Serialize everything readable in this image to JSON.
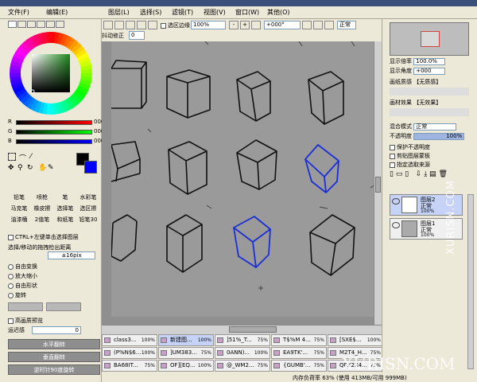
{
  "menu": [
    "文件(F)",
    "编辑(E)",
    "图层(L)",
    "选择(S)",
    "滤镜(T)",
    "视图(V)",
    "窗口(W)",
    "其他(O)"
  ],
  "toolbar": {
    "stabilizer_label": "抖动修正",
    "stabilizer_value": "0",
    "selection_edge_label": "选区边缘",
    "zoom_value": "100%",
    "rotation_value": "+000°",
    "blend_mode": "正常"
  },
  "left": {
    "rgb_labels": [
      "R",
      "G",
      "B"
    ],
    "rgb_values": [
      "000",
      "000",
      "000"
    ],
    "tools": [
      "铅笔",
      "喷枪",
      "笔",
      "水彩笔",
      "马克笔",
      "橡皮擦",
      "选择笔",
      "选区擦",
      "油漆桶",
      "2值笔",
      "和纸笔",
      "铅笔30"
    ],
    "ctrl_option": "CTRL+左键单击选择图层",
    "move_label": "选择/移动的拖拽检出距离",
    "move_value": "±16pix",
    "transform_options": [
      "自由变换",
      "放大缩小",
      "自由形状",
      "旋转"
    ],
    "hq_preview": "高画质预览",
    "speed_label": "运迟感",
    "speed_value": "0",
    "buttons": [
      "水平翻转",
      "垂直翻转",
      "逆时针90度旋转"
    ]
  },
  "right": {
    "nav_zoom_label": "显示倍率",
    "nav_zoom_value": "100.0%",
    "nav_angle_label": "显示角度",
    "nav_angle_value": "+000",
    "paper_texture_label": "画纸质感",
    "paper_texture_value": "【无质感】",
    "paper_effect_label": "画材效果",
    "paper_effect_value": "【无效果】",
    "blend_label": "混合模式",
    "blend_value": "正常",
    "opacity_label": "不透明度",
    "opacity_value": "100%",
    "checks": [
      "保护不透明度",
      "剪贴图层蒙板",
      "指定选取来源"
    ],
    "layers": [
      {
        "name": "图层2",
        "mode": "正常",
        "opacity": "100%"
      },
      {
        "name": "图层1",
        "mode": "正常",
        "opacity": "100%"
      }
    ]
  },
  "doc_tabs": [
    {
      "name": "class3...",
      "pct": "100%"
    },
    {
      "name": "新建图...",
      "pct": "100%"
    },
    {
      "name": "]51%_T...",
      "pct": "75%"
    },
    {
      "name": "T$%M 4...",
      "pct": "75%"
    },
    {
      "name": "[SXE$...",
      "pct": "100%"
    },
    {
      "name": "(P%N$6...",
      "pct": "100%"
    },
    {
      "name": "]UM383...",
      "pct": "75%"
    },
    {
      "name": "0ANN)...",
      "pct": "100%"
    },
    {
      "name": "EA9TK'...",
      "pct": "75%"
    },
    {
      "name": "M2T4_H...",
      "pct": "75%"
    },
    {
      "name": "BA68IT...",
      "pct": "75%"
    },
    {
      "name": "OF][EQ...",
      "pct": "100%"
    },
    {
      "name": "@_WM2...",
      "pct": "75%"
    },
    {
      "name": "{GUMB'...",
      "pct": "75%"
    },
    {
      "name": "QPX2X4...",
      "pct": "75%"
    }
  ],
  "status": "内存负荷率 63% (使用 413MB/可用 999MB)",
  "watermark": "XURISN.COM",
  "colors": {
    "primary": "#000000",
    "secondary": "#0000ff",
    "blue_cube": "#1a2fd6"
  }
}
